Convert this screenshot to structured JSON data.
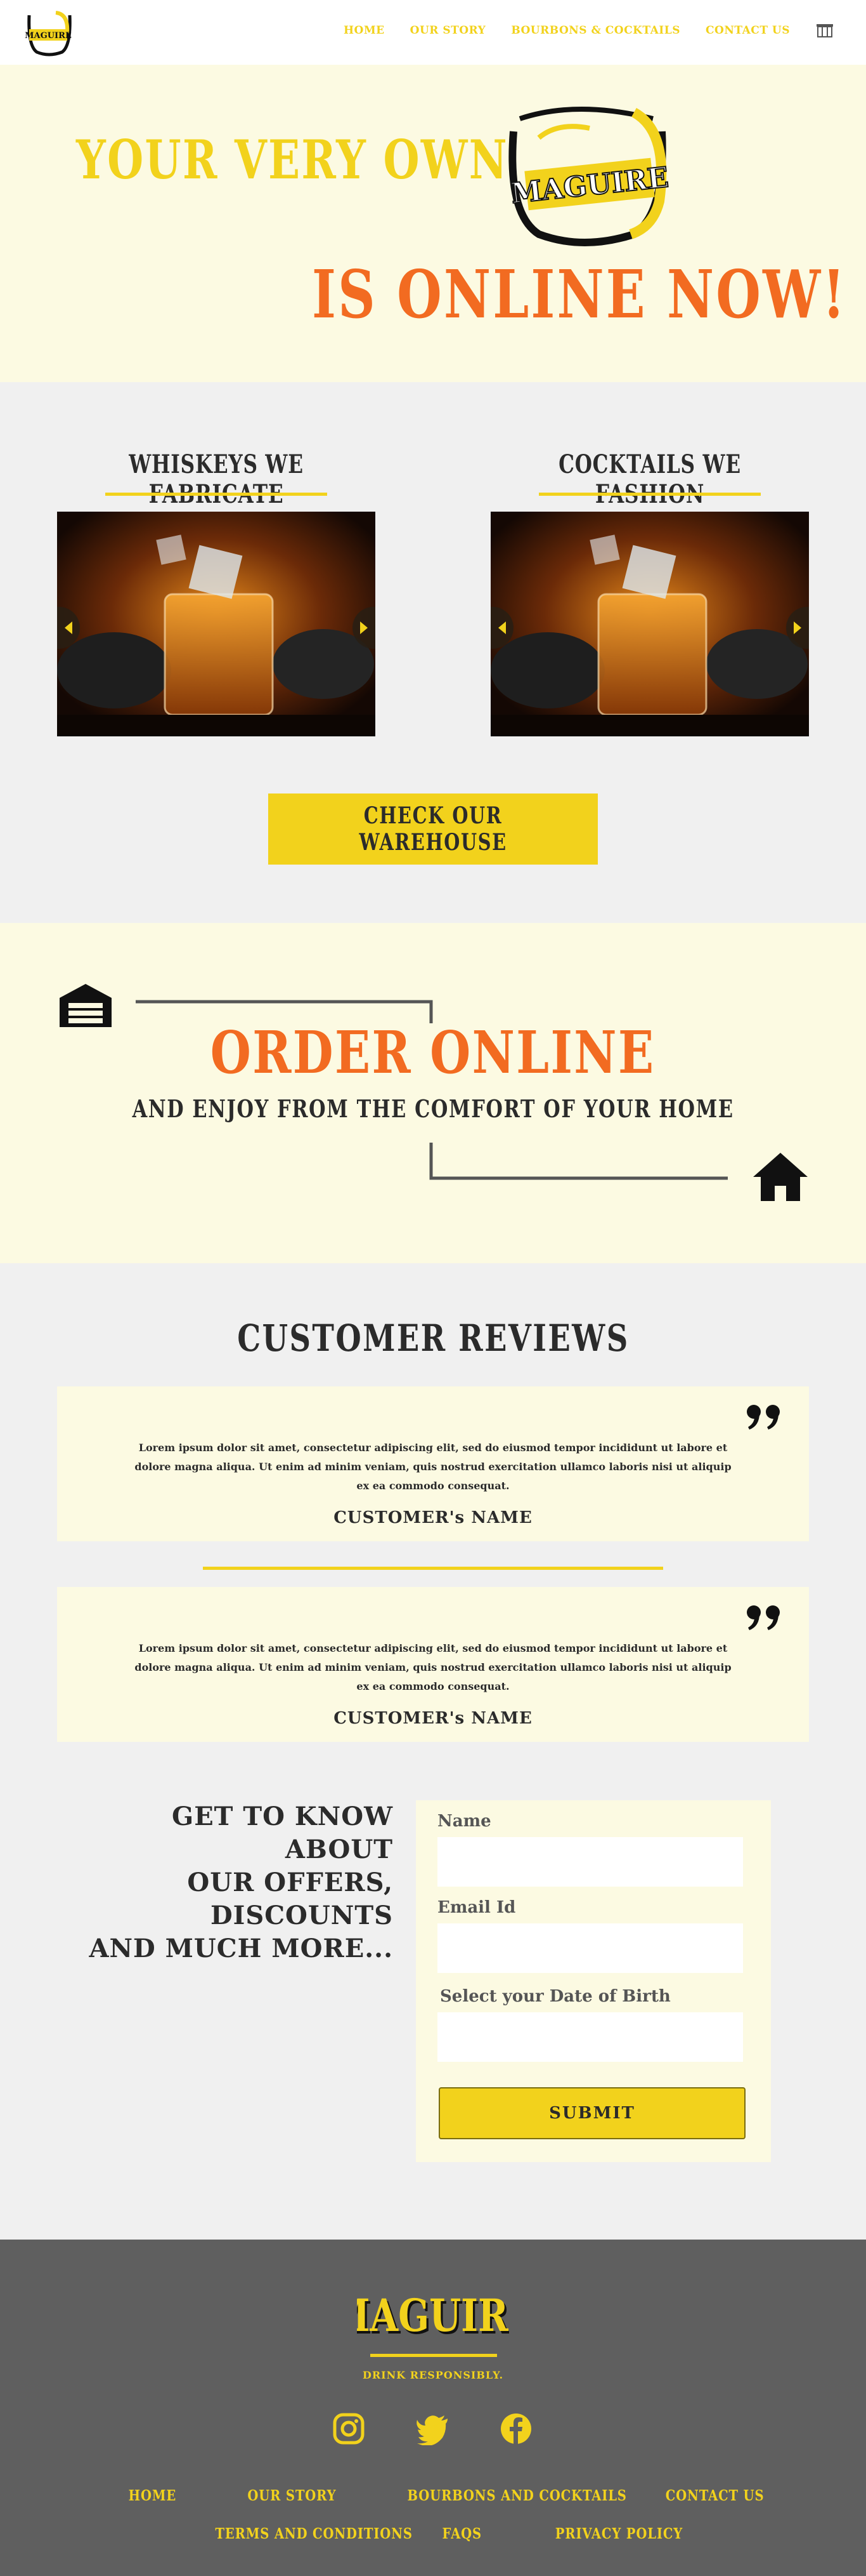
{
  "colors": {
    "accent_yellow": "#f2d21c",
    "accent_orange": "#f26b21",
    "cream": "#fcfae2",
    "light_gray": "#f0f0f0",
    "dark_text": "#2b2b2b",
    "footer_gray": "#5f5f5f"
  },
  "header": {
    "logo_icon": "maguire-glass-logo",
    "nav": [
      "HOME",
      "OUR STORY",
      "BOURBONS & COCKTAILS",
      "CONTACT US"
    ],
    "cart_icon": "store-icon"
  },
  "hero": {
    "line1": "YOUR VERY OWN",
    "logo_text": "MAGUIRE",
    "line2": "IS ONLINE NOW!"
  },
  "products": {
    "left_title": "WHISKEYS WE FABRICATE",
    "right_title": "COCKTAILS WE FASHION",
    "cta": "CHECK OUR WAREHOUSE"
  },
  "order": {
    "title": "ORDER ONLINE",
    "subtitle": "AND ENJOY FROM THE COMFORT OF YOUR HOME",
    "left_icon": "warehouse-icon",
    "right_icon": "home-icon"
  },
  "reviews": {
    "title": "CUSTOMER REVIEWS",
    "items": [
      {
        "text": "Lorem ipsum dolor sit amet, consectetur adipiscing elit, sed do eiusmod tempor incididunt ut labore et dolore magna aliqua. Ut enim ad minim veniam, quis nostrud exercitation ullamco laboris nisi ut aliquip ex ea commodo consequat.",
        "name": "CUSTOMER's NAME"
      },
      {
        "text": "Lorem ipsum dolor sit amet, consectetur adipiscing elit, sed do eiusmod tempor incididunt ut labore et dolore magna aliqua. Ut enim ad minim veniam, quis nostrud exercitation ullamco laboris nisi ut aliquip ex ea commodo consequat.",
        "name": "CUSTOMER's NAME"
      }
    ]
  },
  "newsletter": {
    "line1": "GET TO KNOW ABOUT",
    "line2": "OUR OFFERS, DISCOUNTS",
    "line3": "AND MUCH MORE...",
    "name_label": "Name",
    "email_label": "Email Id",
    "dob_label": "Select your Date of Birth",
    "submit": "SUBMIT"
  },
  "footer": {
    "brand": "MAGUIRE",
    "tagline": "DRINK RESPONSIBLY.",
    "social": [
      "instagram-icon",
      "twitter-icon",
      "facebook-icon"
    ],
    "links_row1": [
      "HOME",
      "OUR STORY",
      "BOURBONS AND COCKTAILS",
      "CONTACT US"
    ],
    "links_row2": [
      "TERMS AND CONDITIONS",
      "FAQS",
      "PRIVACY POLICY"
    ]
  }
}
